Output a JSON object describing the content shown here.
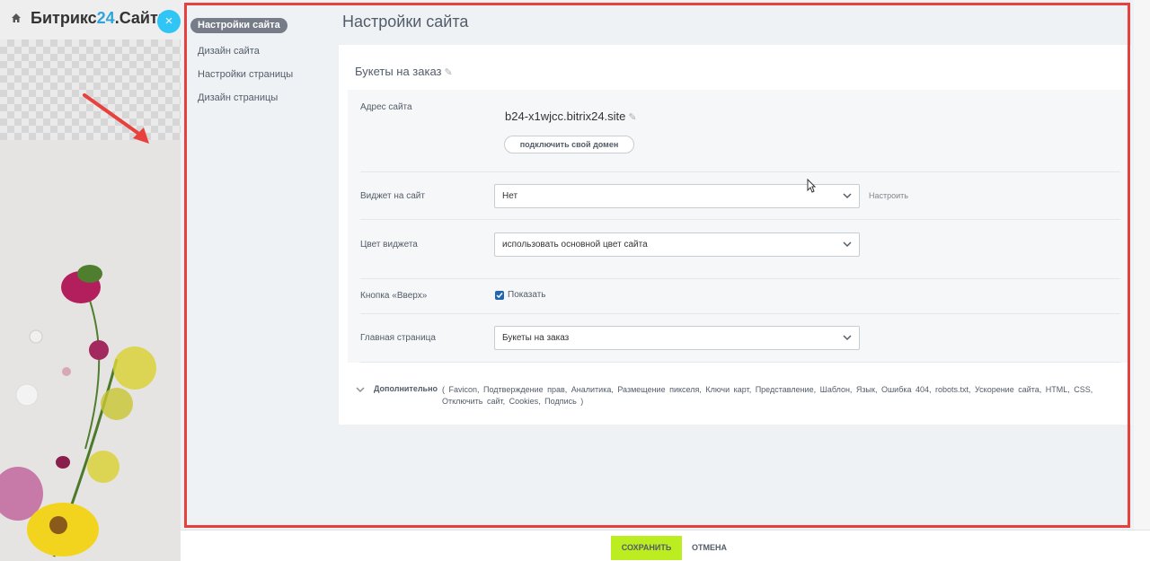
{
  "app": {
    "brand_prefix": "Битрикс",
    "brand_number": "24",
    "brand_suffix": ".Сайты",
    "close_glyph": "×"
  },
  "sidebar": {
    "items": [
      {
        "label": "Настройки сайта",
        "active": true
      },
      {
        "label": "Дизайн сайта",
        "active": false
      },
      {
        "label": "Настройки страницы",
        "active": false
      },
      {
        "label": "Дизайн страницы",
        "active": false
      }
    ]
  },
  "header": {
    "title": "Настройки сайта"
  },
  "site": {
    "name": "Букеты на заказ"
  },
  "form": {
    "address": {
      "label": "Адрес сайта",
      "domain": "b24-x1wjcc.bitrix24.site",
      "connect_button": "подключить свой домен"
    },
    "widget": {
      "label": "Виджет на сайт",
      "value": "Нет",
      "configure_link": "Настроить"
    },
    "widget_color": {
      "label": "Цвет виджета",
      "value": "использовать основной цвет сайта"
    },
    "up_button": {
      "label": "Кнопка «Вверх»",
      "checkbox_label": "Показать",
      "checked": true
    },
    "home_page": {
      "label": "Главная страница",
      "value": "Букеты на заказ"
    }
  },
  "additional": {
    "title": "Дополнительно",
    "items": "( Favicon,  Подтверждение прав,  Аналитика,  Размещение пикселя,  Ключи карт,  Представление,  Шаблон,  Язык,  Ошибка 404,  robots.txt,  Ускорение сайта,  HTML, CSS,  Отключить сайт,  Cookies,  Подпись )"
  },
  "footer": {
    "save_label": "СОХРАНИТЬ",
    "cancel_label": "ОТМЕНА"
  },
  "colors": {
    "accent_save": "#bbed21",
    "highlight_frame": "#e8403d",
    "close_button": "#2fc6f6",
    "brand_number": "#2fa4d8",
    "checkbox": "#2066b0"
  }
}
